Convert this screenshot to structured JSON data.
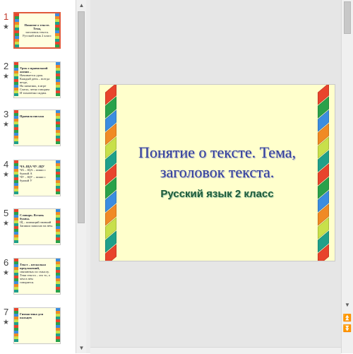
{
  "slides": [
    {
      "number": "1",
      "star": "★",
      "active": true,
      "text": [
        "Понятие о тексте. Тема,",
        "заголовок текста.",
        "Русский язык 2 класс"
      ]
    },
    {
      "number": "2",
      "star": "★",
      "active": false,
      "text": [
        "Урок о правильной жизни –",
        "Начинается урок.",
        "Каждый день – всегда везде,",
        "На занятиях, в игре",
        "Смело, четко говорим",
        "И тихонечко сидим."
      ]
    },
    {
      "number": "3",
      "star": "★",
      "active": false,
      "text": [
        "Правила письма"
      ]
    },
    {
      "number": "4",
      "star": "★",
      "active": false,
      "text": [
        "ЧА–ЩА   ЧУ–ЩУ",
        "ЧА – ЩА – пиши с буквой А",
        "ЧУ – ЩУ – пиши с буквой У"
      ]
    },
    {
      "number": "5",
      "star": "★",
      "active": false,
      "text": [
        "Словарь. Вставь буквы.",
        "Щ – шипящий звонкий",
        "Запиши записью на нём."
      ]
    },
    {
      "number": "6",
      "star": "★",
      "active": false,
      "text": [
        "Текст – несколько предложений,",
        "связанных по смыслу.",
        "Тема текста – это то, о чём в нём",
        "говорится."
      ]
    },
    {
      "number": "7",
      "star": "★",
      "active": false,
      "text": [
        "Гимнастика для пальцев"
      ]
    }
  ],
  "main_slide": {
    "title_line1": "Понятие о тексте. Тема,",
    "title_line2": "заголовок текста.",
    "subtitle": "Русский язык 2 класс"
  },
  "colors": {
    "slide_bg": "#ffffcc",
    "strip": [
      "#e8442c",
      "#2aa14a",
      "#3b8de0",
      "#f08a24",
      "#c8e04a",
      "#1fa08a"
    ],
    "title": "#2f3b9a",
    "subtitle": "#1e5b3a",
    "active_border": "#e05a3c"
  },
  "icons": {
    "scroll_up": "▲",
    "scroll_down": "▼",
    "next_slide": "⏬",
    "prev_slide": "⏫"
  }
}
